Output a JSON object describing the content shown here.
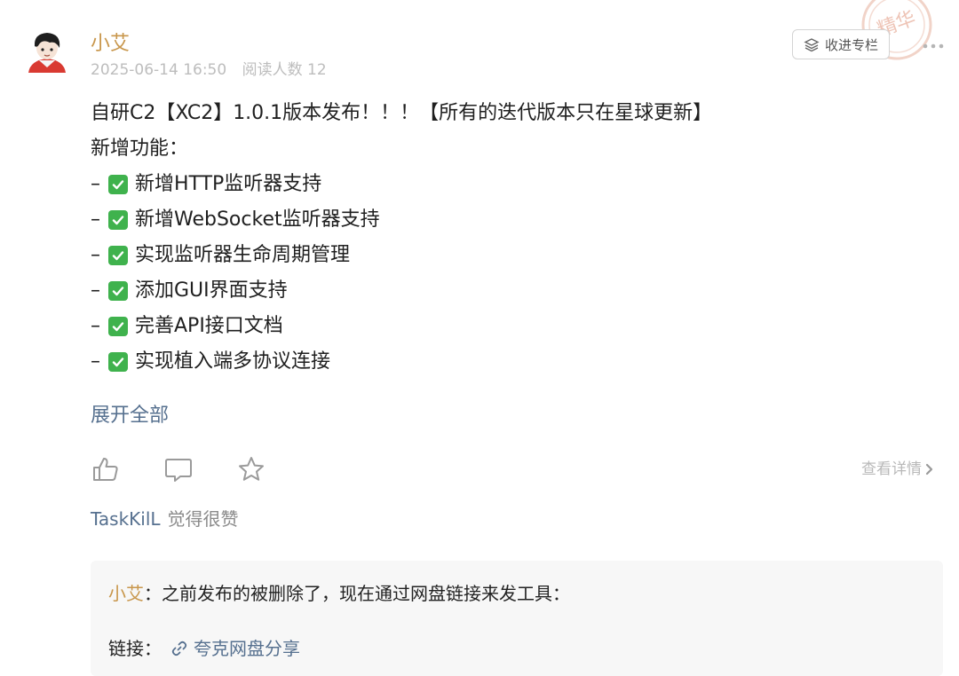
{
  "badge": {
    "text": "精华",
    "color": "#e9b8a8"
  },
  "post": {
    "author": "小艾",
    "date": "2025-06-14 16:50",
    "readers": "阅读人数 12",
    "collect_label": "收进专栏",
    "title": "自研C2【XC2】1.0.1版本发布！！！【所有的迭代版本只在星球更新】",
    "features_heading": "新增功能：",
    "features": [
      "新增HTTP监听器支持",
      "新增WebSocket监听器支持",
      "实现监听器生命周期管理",
      "添加GUI界面支持",
      "完善API接口文档",
      "实现植入端多协议连接"
    ],
    "list_prefix": "–",
    "expand_label": "展开全部",
    "detail_label": "查看详情"
  },
  "likes": {
    "user": "TaskKilL",
    "text": "觉得很赞"
  },
  "comment": {
    "user": "小艾",
    "separator": "：",
    "text": "之前发布的被删除了，现在通过网盘链接来发工具：",
    "link_prefix": "链接：",
    "link_text": "夸克网盘分享"
  },
  "colors": {
    "author": "#c8964b",
    "link": "#56708f",
    "meta": "#bdbdbd",
    "check": "#3fb24d"
  },
  "icons": [
    "more-icon",
    "stack-icon",
    "like-icon",
    "comment-icon",
    "star-icon",
    "chevron-right-icon",
    "link-icon",
    "check-icon"
  ]
}
